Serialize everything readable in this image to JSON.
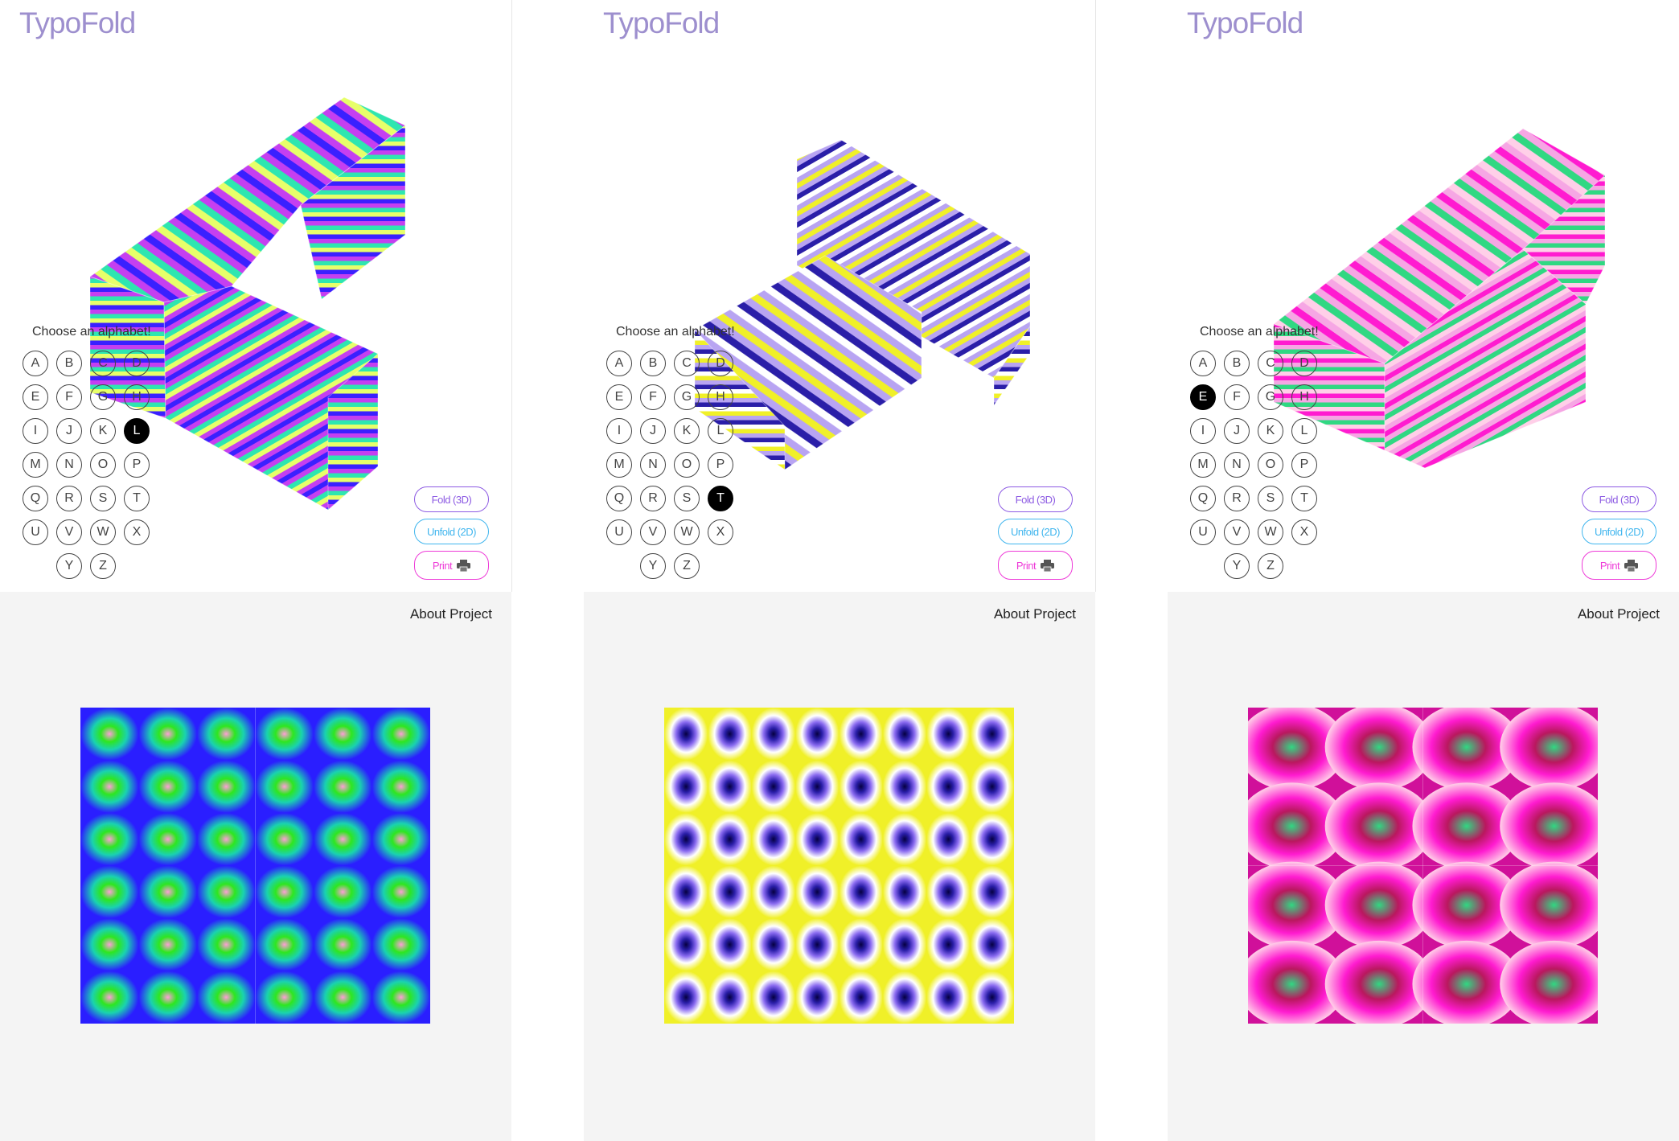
{
  "panels": [
    {
      "app_title": "TypoFold",
      "choose_label": "Choose an alphabet!",
      "selected_letter": "L",
      "buttons": {
        "fold": "Fold (3D)",
        "unfold": "Unfold (2D)",
        "print": "Print"
      },
      "about": "About Project",
      "icons": [
        "printer-icon"
      ],
      "colors": {
        "primary": "#3a20ff",
        "secondary": "#c53ff0",
        "accent": "#2ee6b0",
        "highlight": "#e7ff6a"
      }
    },
    {
      "app_title": "TypoFold",
      "choose_label": "Choose an alphabet!",
      "selected_letter": "T",
      "buttons": {
        "fold": "Fold (3D)",
        "unfold": "Unfold (2D)",
        "print": "Print"
      },
      "about": "About Project",
      "icons": [
        "printer-icon"
      ],
      "colors": {
        "primary": "#f0f028",
        "secondary": "#b8a4f2",
        "accent": "#2a1ea8",
        "highlight": "#ffffff"
      }
    },
    {
      "app_title": "TypoFold",
      "choose_label": "Choose an alphabet!",
      "selected_letter": "E",
      "buttons": {
        "fold": "Fold (3D)",
        "unfold": "Unfold (2D)",
        "print": "Print"
      },
      "about": "About Project",
      "icons": [
        "printer-icon"
      ],
      "colors": {
        "primary": "#ff1bd0",
        "secondary": "#f6a6e4",
        "accent": "#30d882",
        "highlight": "#ffcfe8"
      }
    }
  ],
  "letters": [
    "A",
    "B",
    "C",
    "D",
    "E",
    "F",
    "G",
    "H",
    "I",
    "J",
    "K",
    "L",
    "M",
    "N",
    "O",
    "P",
    "Q",
    "R",
    "S",
    "T",
    "U",
    "V",
    "W",
    "X",
    "Y",
    "Z"
  ]
}
